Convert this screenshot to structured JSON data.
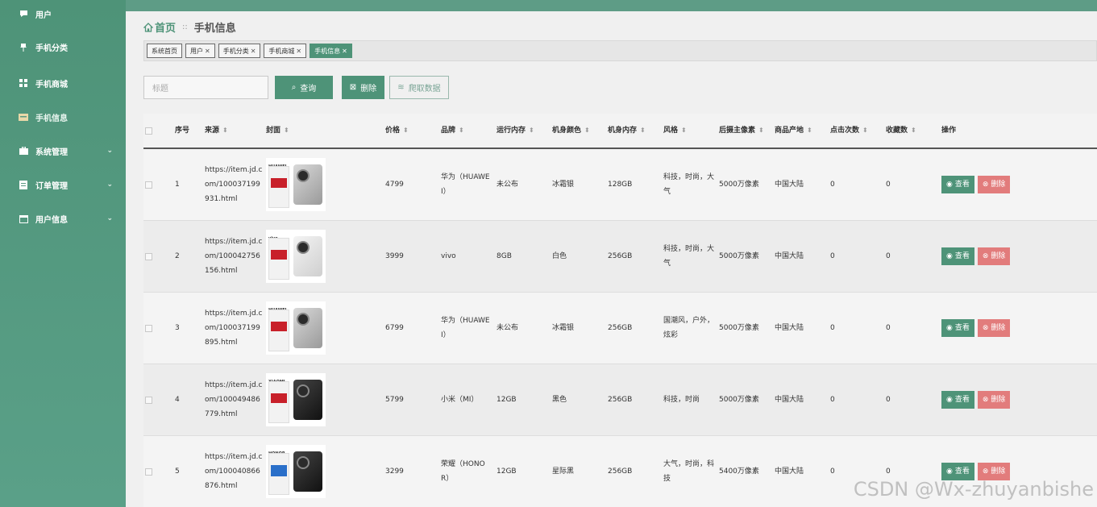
{
  "sidebar": {
    "items": [
      {
        "label": "用户",
        "icon": "chat-icon",
        "has_children": false
      },
      {
        "label": "手机分类",
        "icon": "pin-icon",
        "has_children": false
      },
      {
        "label": "手机商城",
        "icon": "grid-icon",
        "has_children": false
      },
      {
        "label": "手机信息",
        "icon": "card-icon",
        "has_children": false
      },
      {
        "label": "系统管理",
        "icon": "briefcase-icon",
        "has_children": true
      },
      {
        "label": "订单管理",
        "icon": "document-icon",
        "has_children": true
      },
      {
        "label": "用户信息",
        "icon": "calendar-icon",
        "has_children": true
      }
    ]
  },
  "breadcrumb": {
    "home": "首页",
    "separator": "::",
    "current": "手机信息"
  },
  "tabs": [
    {
      "label": "系统首页",
      "closable": false
    },
    {
      "label": "用户",
      "closable": true
    },
    {
      "label": "手机分类",
      "closable": true
    },
    {
      "label": "手机商城",
      "closable": true
    },
    {
      "label": "手机信息",
      "closable": true,
      "active": true
    }
  ],
  "toolbar": {
    "search_placeholder": "标题",
    "query_label": "查询",
    "delete_label": "删除",
    "crawl_label": "爬取数据"
  },
  "table": {
    "headers": {
      "idx": "序号",
      "source": "来源",
      "cover": "封面",
      "price": "价格",
      "brand": "品牌",
      "ram": "运行内存",
      "color": "机身颜色",
      "rom": "机身内存",
      "style": "风格",
      "camera": "后摄主像素",
      "origin": "商品产地",
      "clicks": "点击次数",
      "favorites": "收藏数",
      "ops": "操作"
    },
    "rows": [
      {
        "idx": "1",
        "source": "https://item.jd.com/100037199931.html",
        "cover_brand": "HUAWEI",
        "price": "4799",
        "brand": "华为（HUAWEI）",
        "ram": "未公布",
        "color": "冰霜银",
        "rom": "128GB",
        "style": "科技，时尚，大气",
        "camera": "5000万像素",
        "origin": "中国大陆",
        "clicks": "0",
        "favorites": "0"
      },
      {
        "idx": "2",
        "source": "https://item.jd.com/100042756156.html",
        "cover_brand": "vivo",
        "price": "3999",
        "brand": "vivo",
        "ram": "8GB",
        "color": "白色",
        "rom": "256GB",
        "style": "科技，时尚，大气",
        "camera": "5000万像素",
        "origin": "中国大陆",
        "clicks": "0",
        "favorites": "0"
      },
      {
        "idx": "3",
        "source": "https://item.jd.com/100037199895.html",
        "cover_brand": "HUAWEI",
        "price": "6799",
        "brand": "华为（HUAWEI）",
        "ram": "未公布",
        "color": "冰霜银",
        "rom": "256GB",
        "style": "国潮风，户外，炫彩",
        "camera": "5000万像素",
        "origin": "中国大陆",
        "clicks": "0",
        "favorites": "0"
      },
      {
        "idx": "4",
        "source": "https://item.jd.com/100049486779.html",
        "cover_brand": "XIAOMI",
        "price": "5799",
        "brand": "小米（MI）",
        "ram": "12GB",
        "color": "黑色",
        "rom": "256GB",
        "style": "科技，时尚",
        "camera": "5000万像素",
        "origin": "中国大陆",
        "clicks": "0",
        "favorites": "0"
      },
      {
        "idx": "5",
        "source": "https://item.jd.com/100040866876.html",
        "cover_brand": "HONOR",
        "price": "3299",
        "brand": "荣耀（HONOR）",
        "ram": "12GB",
        "color": "星际黑",
        "rom": "256GB",
        "style": "大气，时尚，科技",
        "camera": "5400万像素",
        "origin": "中国大陆",
        "clicks": "0",
        "favorites": "0"
      }
    ],
    "ops": {
      "view_label": "查看",
      "delete_label": "删除"
    }
  },
  "watermark": "CSDN @Wx-zhuyanbishe",
  "colors": {
    "primary": "#4e9378",
    "danger": "#e27c7c"
  }
}
